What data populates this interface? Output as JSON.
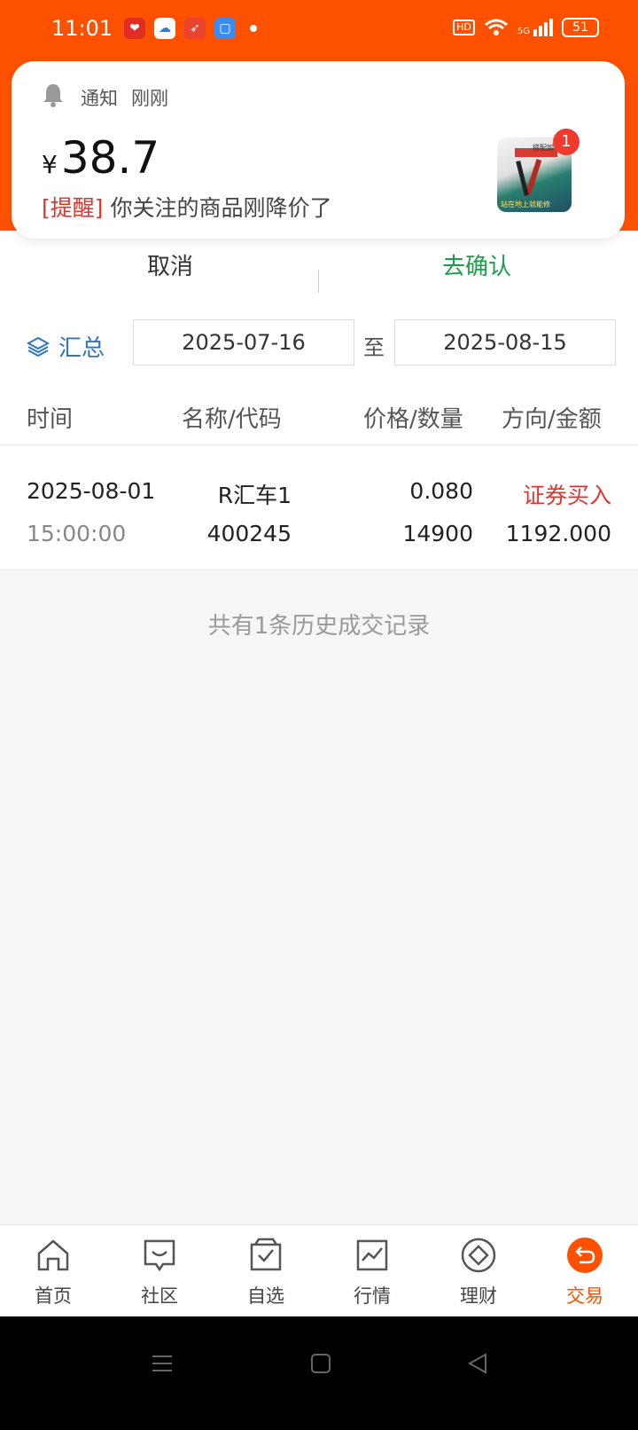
{
  "status_bar": {
    "time": "11:01",
    "battery": "51",
    "hd": "HD",
    "net": "5G",
    "app_icons": [
      "pinduoduo-icon",
      "baidu-netdisk-icon",
      "paper-plane-app-icon",
      "messages-app-icon"
    ]
  },
  "notification": {
    "app_name": "通知",
    "time": "刚刚",
    "currency": "¥",
    "price": "38.7",
    "tag": "[提醒]",
    "message": "你关注的商品刚降价了",
    "badge_count": "1",
    "thumb_text_top": "搭配加长杆",
    "thumb_text_bottom": "站在地上就能修"
  },
  "tabs": {
    "cancel": "取消",
    "confirm": "去确认"
  },
  "filter": {
    "summary_label": "汇总",
    "start_date": "2025-07-16",
    "to_label": "至",
    "end_date": "2025-08-15"
  },
  "table": {
    "headers": [
      "时间",
      "名称/代码",
      "价格/数量",
      "方向/金额"
    ],
    "rows": [
      {
        "date": "2025-08-01",
        "time": "15:00:00",
        "name": "R汇车1",
        "code": "400245",
        "price": "0.080",
        "quantity": "14900",
        "direction": "证券买入",
        "amount": "1192.000"
      }
    ]
  },
  "footer_note": "共有1条历史成交记录",
  "bottom_nav": [
    {
      "label": "首页",
      "icon": "home-icon"
    },
    {
      "label": "社区",
      "icon": "chat-icon"
    },
    {
      "label": "自选",
      "icon": "checked-bag-icon"
    },
    {
      "label": "行情",
      "icon": "chart-icon"
    },
    {
      "label": "理财",
      "icon": "diamond-icon"
    },
    {
      "label": "交易",
      "icon": "exchange-icon",
      "active": true
    }
  ],
  "colors": {
    "brand": "#fe5100",
    "confirm_green": "#1aa04b",
    "buy_red": "#e0342f",
    "link_blue": "#2b74c4"
  }
}
